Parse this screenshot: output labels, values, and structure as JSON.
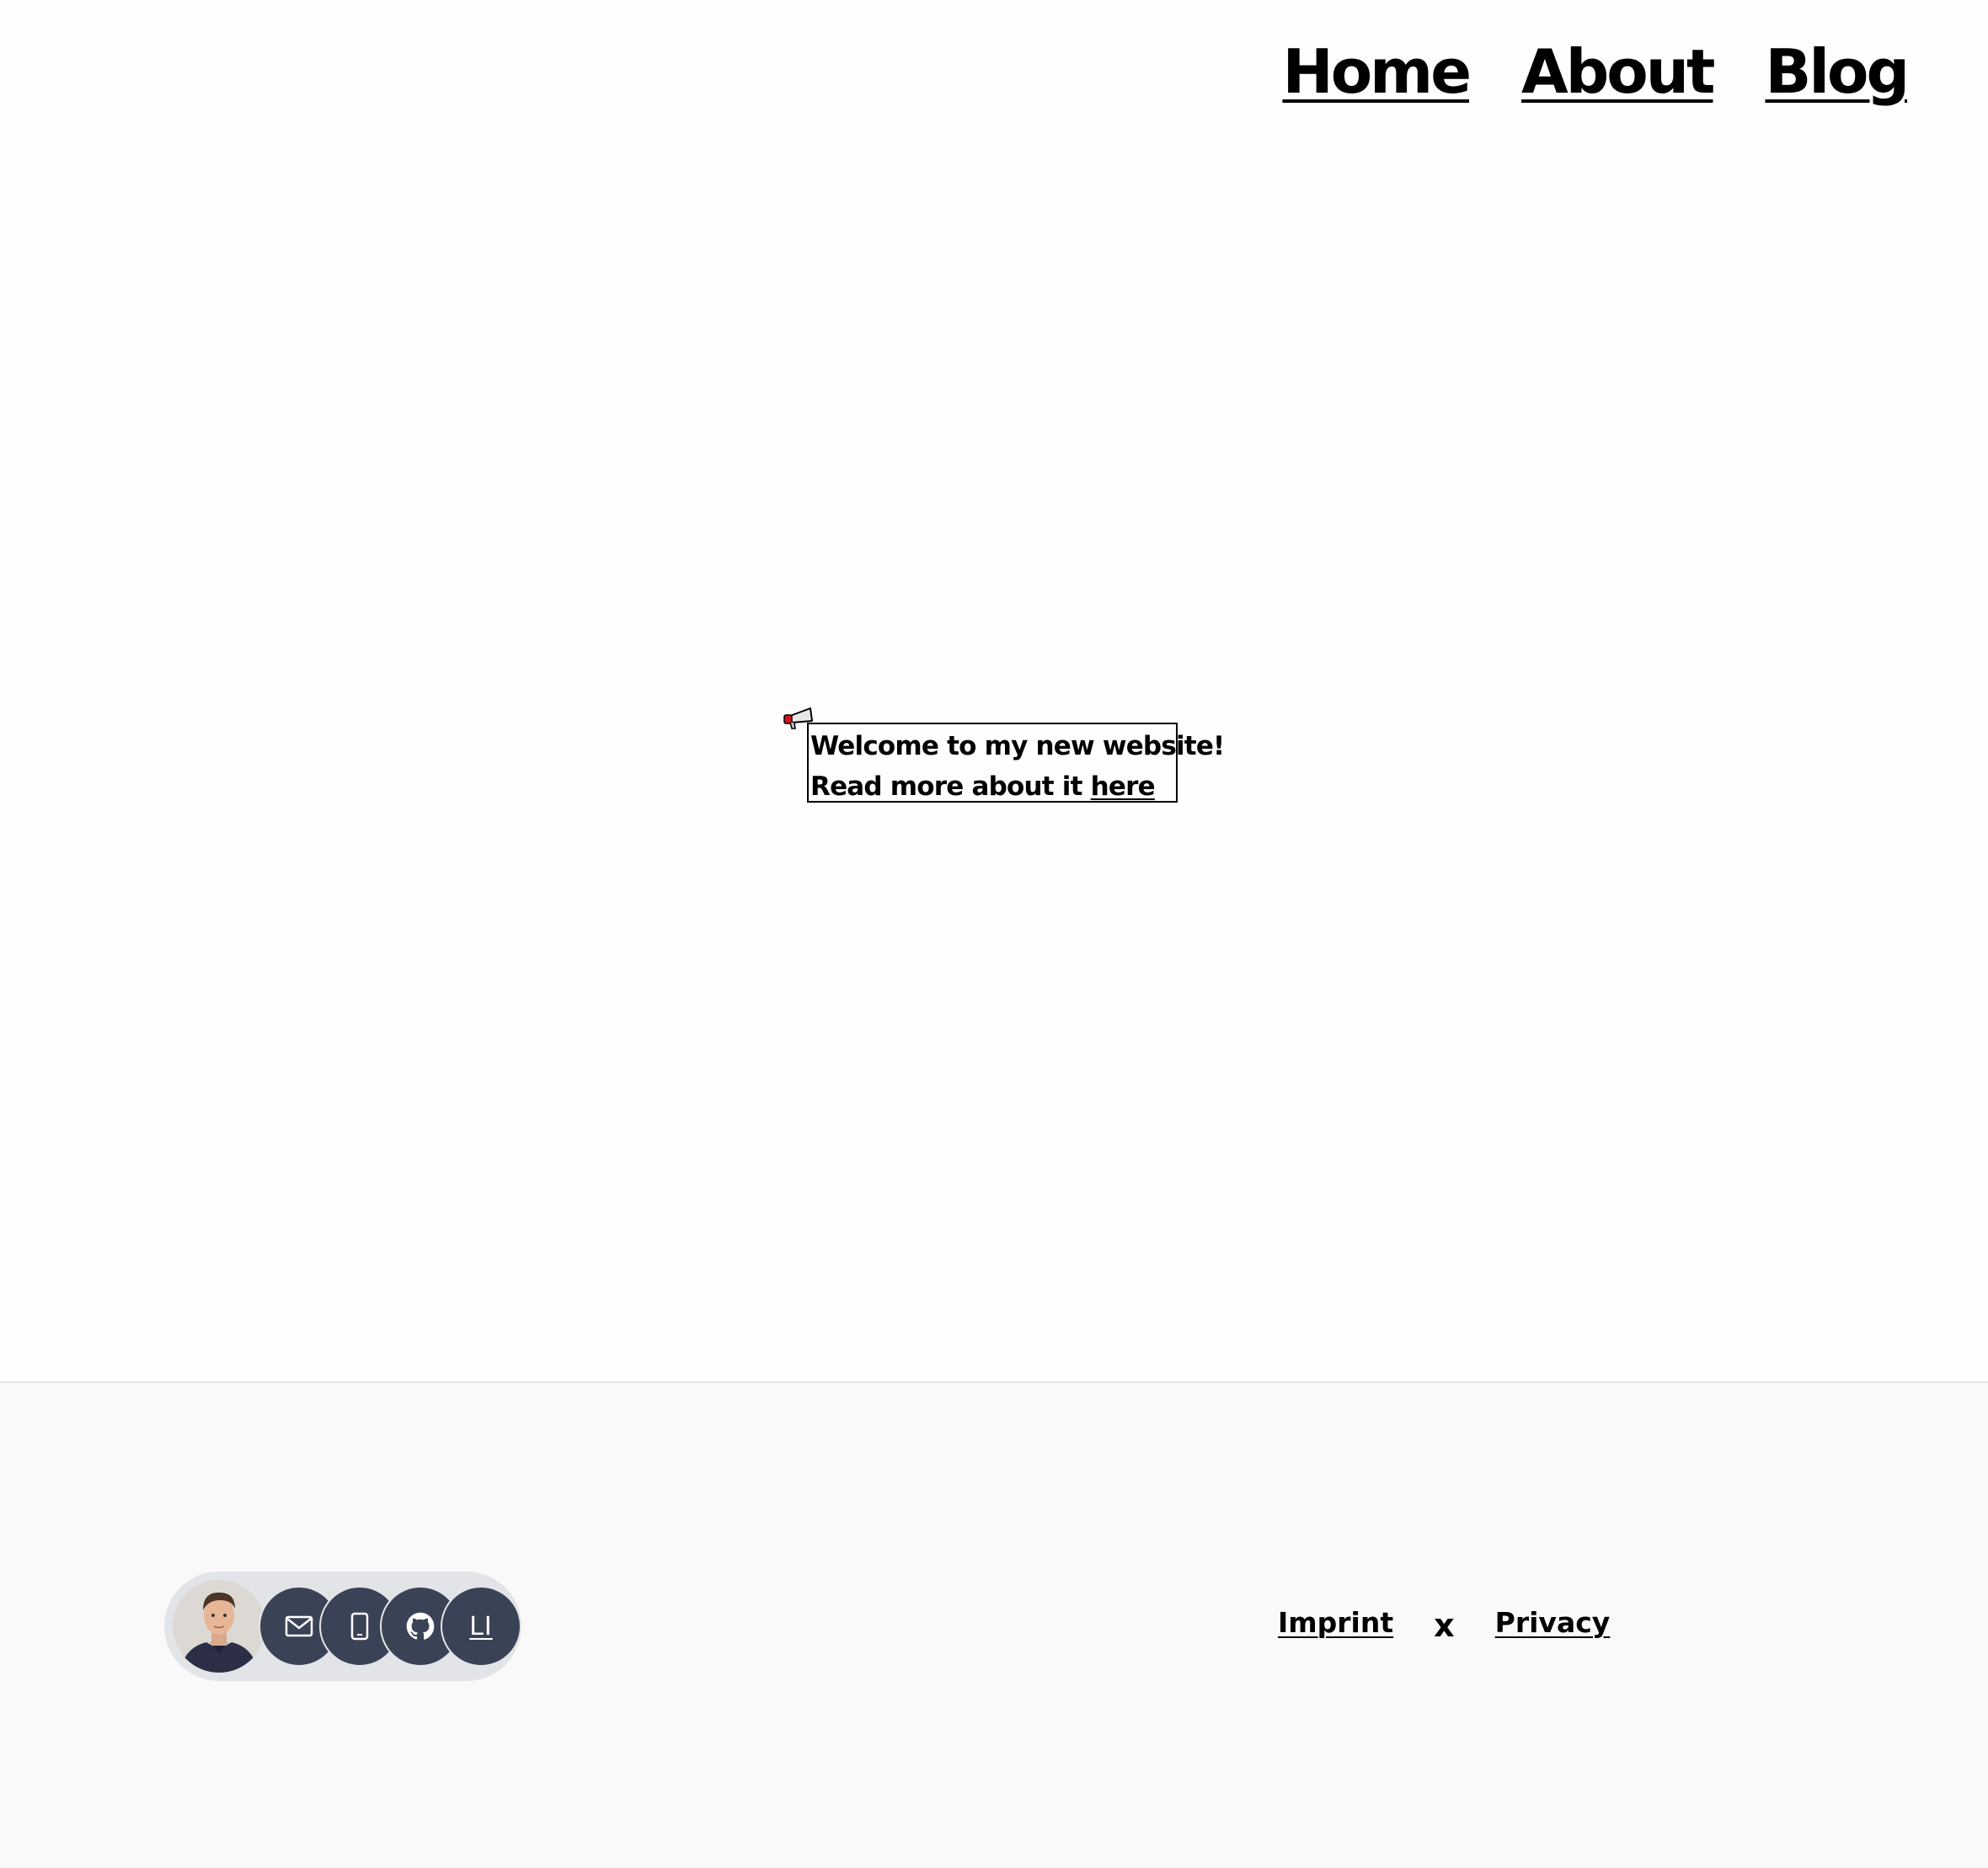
{
  "nav": {
    "items": [
      {
        "label": "Home"
      },
      {
        "label": "About"
      },
      {
        "label": "Blog"
      }
    ]
  },
  "announcement": {
    "icon": "megaphone-icon",
    "line1": "Welcome to my new website!",
    "line2_prefix": "Read more about it ",
    "link_label": "here"
  },
  "footer": {
    "contact": {
      "avatar": "profile-photo",
      "buttons": [
        {
          "icon": "mail-icon"
        },
        {
          "icon": "phone-icon"
        },
        {
          "icon": "github-icon"
        },
        {
          "icon": "linkedin-icon",
          "label": "LI"
        }
      ]
    },
    "links": {
      "imprint": "Imprint",
      "separator": "x",
      "privacy": "Privacy"
    }
  },
  "colors": {
    "footer_bg": "#f9f9f9",
    "pill_bg": "#e3e4e7",
    "button_bg": "#3a4255",
    "megaphone_red": "#d0121b"
  }
}
